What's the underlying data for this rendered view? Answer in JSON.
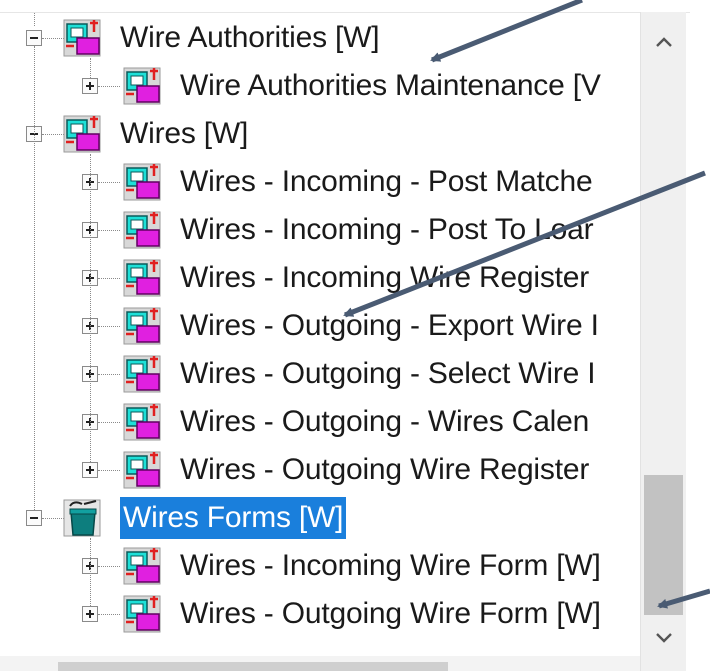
{
  "tree": {
    "groups": [
      {
        "label": "Wire Authorities [W]",
        "expanded": true,
        "icon": "report-group-icon",
        "selected": false,
        "children": [
          {
            "label": "Wire Authorities Maintenance [V",
            "icon": "report-icon"
          }
        ]
      },
      {
        "label": "Wires [W]",
        "expanded": true,
        "icon": "report-group-icon",
        "selected": false,
        "children": [
          {
            "label": "Wires - Incoming - Post Matche",
            "icon": "report-icon"
          },
          {
            "label": "Wires - Incoming - Post To Loar",
            "icon": "report-icon"
          },
          {
            "label": "Wires - Incoming Wire Register",
            "icon": "report-icon"
          },
          {
            "label": "Wires - Outgoing - Export Wire I",
            "icon": "report-icon"
          },
          {
            "label": "Wires - Outgoing - Select Wire I",
            "icon": "report-icon"
          },
          {
            "label": "Wires - Outgoing - Wires Calen",
            "icon": "report-icon"
          },
          {
            "label": "Wires - Outgoing Wire Register",
            "icon": "report-icon"
          }
        ]
      },
      {
        "label": "Wires Forms [W]",
        "expanded": true,
        "icon": "form-folder-icon",
        "selected": true,
        "children": [
          {
            "label": "Wires - Incoming Wire Form [W]",
            "icon": "report-icon"
          },
          {
            "label": "Wires - Outgoing Wire Form [W]",
            "icon": "report-icon"
          }
        ]
      }
    ]
  },
  "scrollbar": {
    "up_icon": "chevron-up-icon",
    "down_icon": "chevron-down-icon"
  },
  "colors": {
    "selection": "#1a7fdc",
    "arrow": "#4a5b73",
    "icon_cyan": "#1ee0d8",
    "icon_magenta": "#e020e0",
    "icon_red": "#e02020"
  }
}
